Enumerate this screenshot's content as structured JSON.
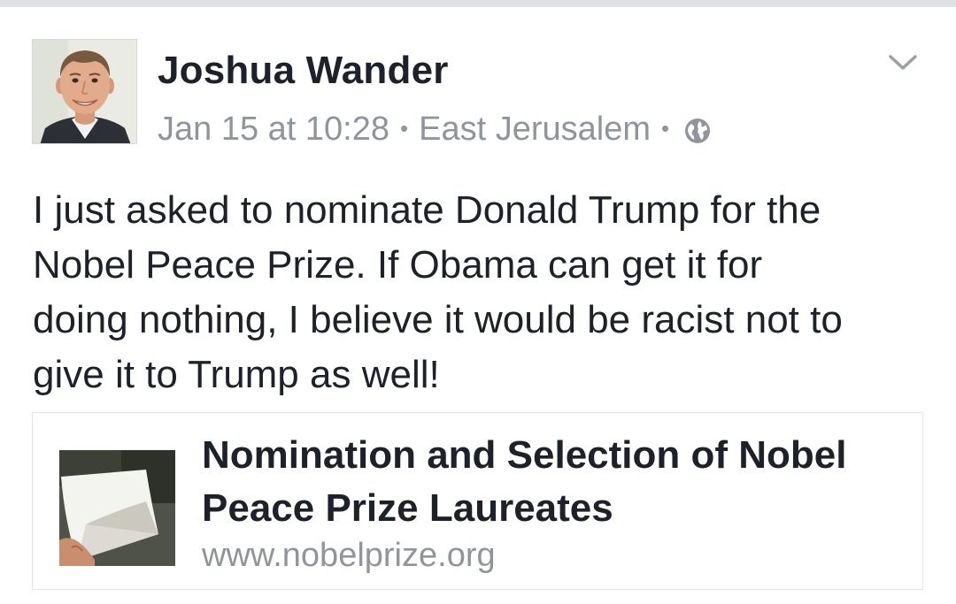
{
  "post": {
    "author": "Joshua Wander",
    "timestamp": "Jan 15 at 10:28",
    "separator": "•",
    "location": "East Jerusalem",
    "privacy_icon": "globe-icon",
    "menu_icon": "chevron-down-icon",
    "text": "I just asked to nominate Donald Trump for the\nNobel Peace Prize. If Obama can get it for\ndoing nothing, I believe it would be racist not to\ngive it to Trump as well!"
  },
  "link_preview": {
    "title": "Nomination and Selection of Nobel Peace Prize Laureates",
    "domain": "www.nobelprize.org",
    "thumbnail_icon": "document-photo-thumbnail"
  },
  "colors": {
    "text_primary": "#1d2129",
    "text_secondary": "#90949c",
    "border": "#e1e3e7",
    "top_strip": "#dfe1e4"
  }
}
